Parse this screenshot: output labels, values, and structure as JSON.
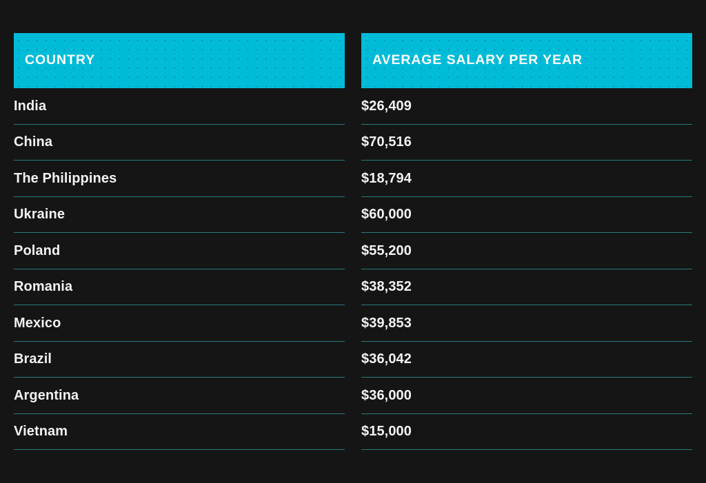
{
  "table": {
    "headers": {
      "country": "COUNTRY",
      "salary": "AVERAGE SALARY PER YEAR"
    },
    "rows": [
      {
        "country": "India",
        "salary": "$26,409"
      },
      {
        "country": "China",
        "salary": "$70,516"
      },
      {
        "country": "The Philippines",
        "salary": "$18,794"
      },
      {
        "country": "Ukraine",
        "salary": "$60,000"
      },
      {
        "country": "Poland",
        "salary": "$55,200"
      },
      {
        "country": "Romania",
        "salary": "$38,352"
      },
      {
        "country": "Mexico",
        "salary": "$39,853"
      },
      {
        "country": "Brazil",
        "salary": "$36,042"
      },
      {
        "country": "Argentina",
        "salary": "$36,000"
      },
      {
        "country": "Vietnam",
        "salary": "$15,000"
      }
    ]
  },
  "chart_data": {
    "type": "table",
    "title": "",
    "columns": [
      "COUNTRY",
      "AVERAGE SALARY PER YEAR"
    ],
    "categories": [
      "India",
      "China",
      "The Philippines",
      "Ukraine",
      "Poland",
      "Romania",
      "Mexico",
      "Brazil",
      "Argentina",
      "Vietnam"
    ],
    "values": [
      26409,
      70516,
      18794,
      60000,
      55200,
      38352,
      39853,
      36042,
      36000,
      15000
    ],
    "value_labels": [
      "$26,409",
      "$70,516",
      "$18,794",
      "$60,000",
      "$55,200",
      "$38,352",
      "$39,853",
      "$36,042",
      "$36,000",
      "$15,000"
    ],
    "unit": "USD per year",
    "xlabel": "Country",
    "ylabel": "Average salary per year"
  },
  "colors": {
    "background": "#151515",
    "header_background": "#00BCD9",
    "header_text": "#FFFFFF",
    "row_text": "#F2F2F2",
    "divider": "#2A787E"
  }
}
